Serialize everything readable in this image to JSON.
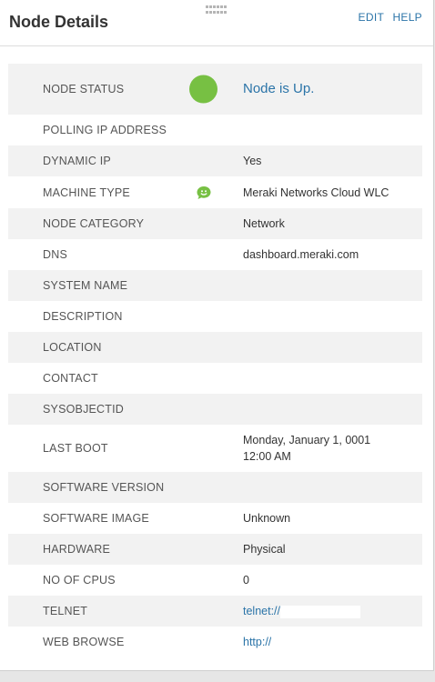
{
  "panel": {
    "title": "Node Details",
    "edit_label": "EDIT",
    "help_label": "HELP"
  },
  "rows": [
    {
      "label": "NODE STATUS",
      "value": "Node is Up.",
      "icon": "status-up-dot",
      "status_color": "#77c043"
    },
    {
      "label": "POLLING IP ADDRESS",
      "value": ""
    },
    {
      "label": "DYNAMIC IP",
      "value": "Yes"
    },
    {
      "label": "MACHINE TYPE",
      "value": "Meraki Networks Cloud WLC",
      "icon": "meraki-icon"
    },
    {
      "label": "NODE CATEGORY",
      "value": "Network"
    },
    {
      "label": "DNS",
      "value": "dashboard.meraki.com"
    },
    {
      "label": "SYSTEM NAME",
      "value": ""
    },
    {
      "label": "DESCRIPTION",
      "value": ""
    },
    {
      "label": "LOCATION",
      "value": ""
    },
    {
      "label": "CONTACT",
      "value": ""
    },
    {
      "label": "SYSOBJECTID",
      "value": ""
    },
    {
      "label": "LAST BOOT",
      "value_line1": "Monday, January 1, 0001",
      "value_line2": "12:00 AM"
    },
    {
      "label": "SOFTWARE VERSION",
      "value": ""
    },
    {
      "label": "SOFTWARE IMAGE",
      "value": "Unknown"
    },
    {
      "label": "HARDWARE",
      "value": "Physical"
    },
    {
      "label": "NO OF CPUS",
      "value": "0"
    },
    {
      "label": "TELNET",
      "value": "telnet://"
    },
    {
      "label": "WEB BROWSE",
      "value": "http://"
    }
  ]
}
